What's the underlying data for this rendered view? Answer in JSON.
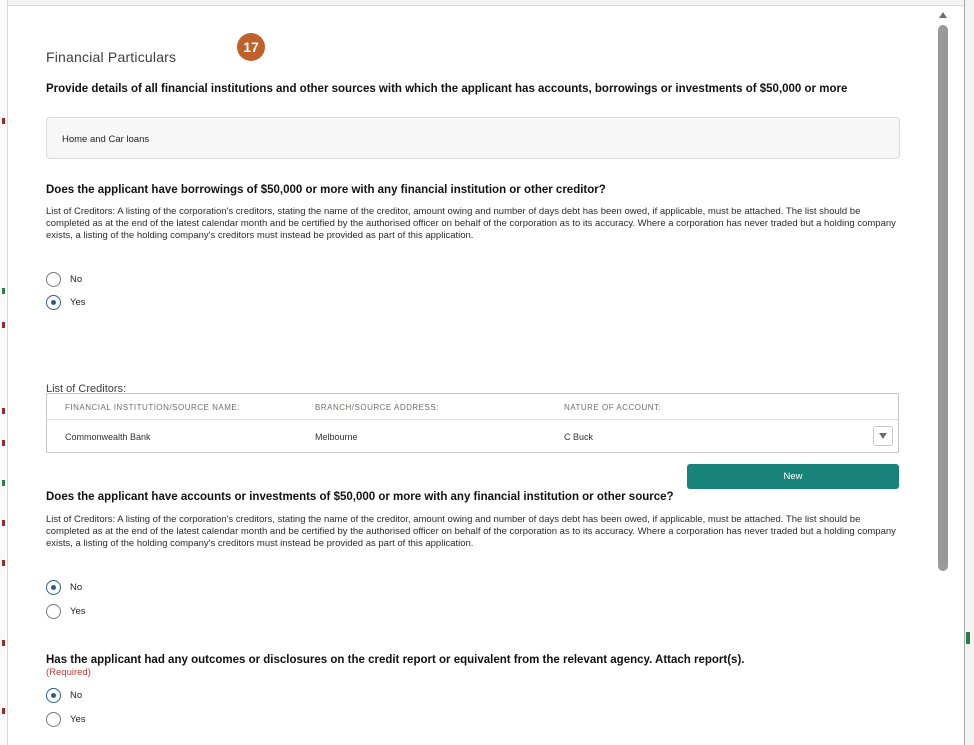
{
  "section": {
    "title": "Financial Particulars",
    "step_badge": "17"
  },
  "institutions": {
    "question": "Provide details of all financial institutions and other sources with which the applicant has accounts, borrowings or investments of $50,000 or more",
    "value": "Home and Car loans"
  },
  "borrowings": {
    "question": "Does the applicant have borrowings of $50,000 or more with any financial institution or other creditor?",
    "description": "List of Creditors: A listing of the corporation's creditors, stating the name of the creditor, amount owing and number of days debt has been owed, if applicable, must be attached. The list should be completed as at the end of the latest calendar month and be certified by the authorised officer on behalf of the corporation as to its accuracy. Where a corporation has never traded but a holding company exists, a listing of the holding company's creditors must instead be provided as part of this application.",
    "options": [
      "No",
      "Yes"
    ],
    "selected": "Yes"
  },
  "creditors": {
    "label": "List of Creditors:",
    "columns": [
      "FINANCIAL INSTITUTION/SOURCE NAME:",
      "BRANCH/SOURCE ADDRESS:",
      "NATURE OF ACCOUNT:"
    ],
    "rows": [
      [
        "Commonwealth Bank",
        "Melbourne",
        "C Buck"
      ]
    ],
    "new_label": "New"
  },
  "investments": {
    "question": "Does the applicant have accounts or investments of $50,000 or more with any financial institution or other source?",
    "description": "List of Creditors: A listing of the corporation's creditors, stating the name of the creditor, amount owing and number of days debt has been owed, if applicable, must be attached. The list should be completed as at the end of the latest calendar month and be certified by the authorised officer on behalf of the corporation as to its accuracy. Where a corporation has never traded but a holding company exists, a listing of the holding company's creditors must instead be provided as part of this application.",
    "options": [
      "No",
      "Yes"
    ],
    "selected": "No"
  },
  "credit_report": {
    "question": "Has the applicant had any outcomes or disclosures on the credit report or equivalent from the relevant agency. Attach report(s).",
    "required_label": "(Required)",
    "options": [
      "No",
      "Yes"
    ],
    "selected": "No"
  },
  "colors": {
    "accent": "#18837a",
    "badge": "#c0612a",
    "required": "#c23934",
    "radio_selected": "#2a5d8a"
  }
}
